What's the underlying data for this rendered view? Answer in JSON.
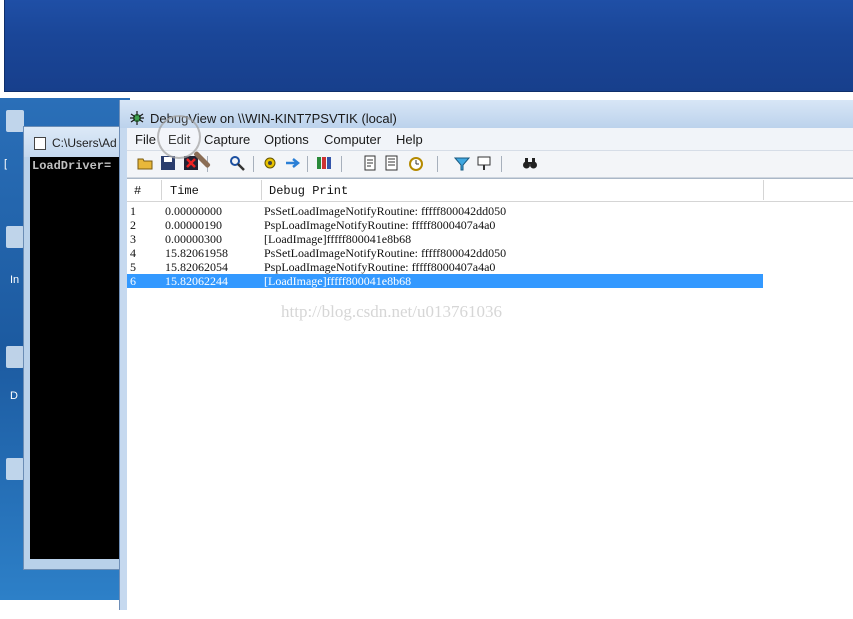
{
  "console": {
    "title": "C:\\Users\\Ad",
    "output_line": "LoadDriver="
  },
  "desktop": {
    "labels": [
      "In",
      "D",
      "["
    ]
  },
  "debugview": {
    "title": "DebugView on \\\\WIN-KINT7PSVTIK (local)",
    "menu": [
      "File",
      "Edit",
      "Capture",
      "Options",
      "Computer",
      "Help"
    ],
    "toolbar_icons": [
      "open-icon",
      "save-icon",
      "clear-icon",
      "find-icon",
      "capture-icon",
      "autoscroll-icon",
      "filter-icon",
      "log-icon",
      "clock-icon",
      "highlight-icon",
      "history-icon",
      "binoculars-icon"
    ],
    "columns": [
      "#",
      "Time",
      "Debug Print"
    ],
    "rows": [
      {
        "n": "1",
        "time": "0.00000000",
        "msg": "PsSetLoadImageNotifyRoutine: fffff800042dd050"
      },
      {
        "n": "2",
        "time": "0.00000190",
        "msg": "PspLoadImageNotifyRoutine: fffff8000407a4a0"
      },
      {
        "n": "3",
        "time": "0.00000300",
        "msg": "[LoadImage]fffff800041e8b68"
      },
      {
        "n": "4",
        "time": "15.82061958",
        "msg": "PsSetLoadImageNotifyRoutine: fffff800042dd050"
      },
      {
        "n": "5",
        "time": "15.82062054",
        "msg": "PspLoadImageNotifyRoutine: fffff8000407a4a0"
      },
      {
        "n": "6",
        "time": "15.82062244",
        "msg": "[LoadImage]fffff800041e8b68"
      }
    ],
    "selected_row": "6"
  },
  "watermark": "http://blog.csdn.net/u013761036",
  "colors": {
    "selection": "#3399ff",
    "banner": "#1a4698"
  }
}
